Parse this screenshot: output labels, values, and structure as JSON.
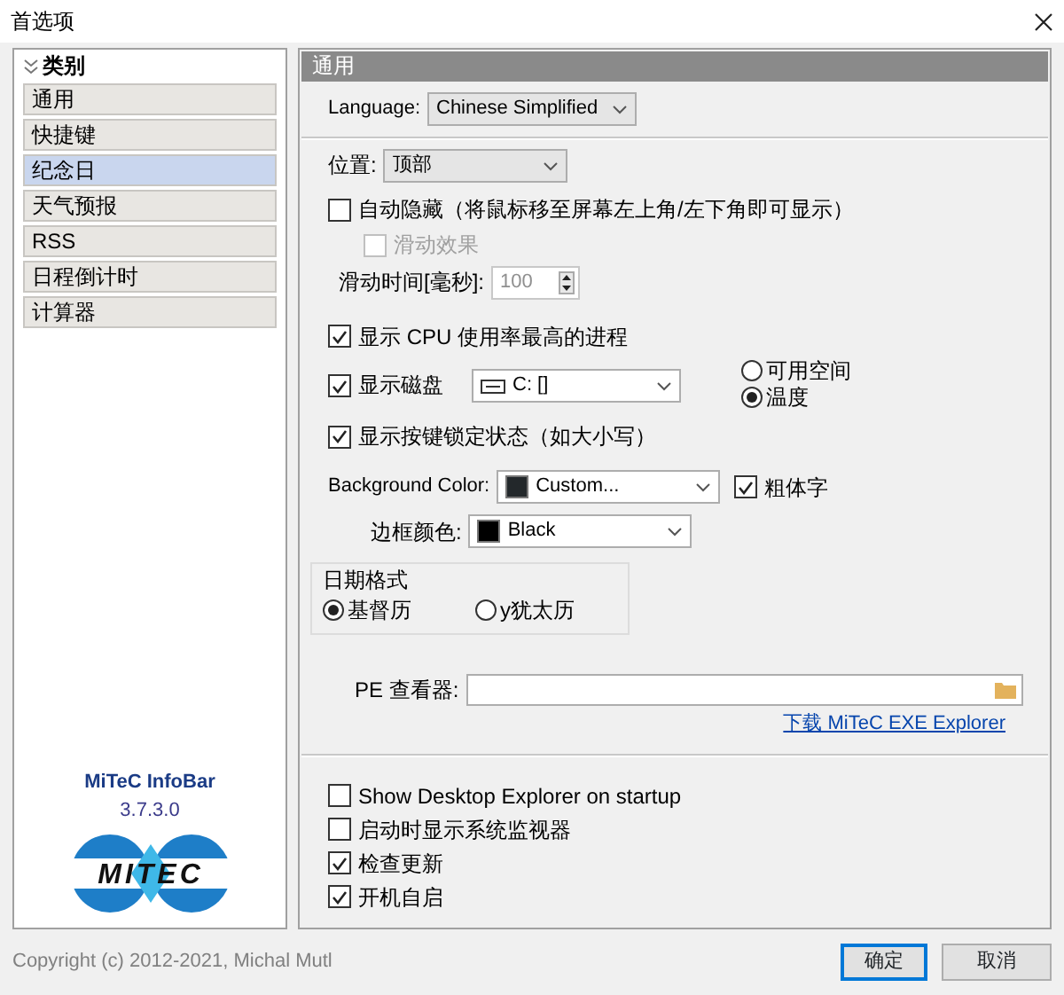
{
  "window": {
    "title": "首选项"
  },
  "sidebar": {
    "header": "类别",
    "items": [
      {
        "label": "通用",
        "selected": false
      },
      {
        "label": "快捷键",
        "selected": false
      },
      {
        "label": "纪念日",
        "selected": true
      },
      {
        "label": "天气预报",
        "selected": false
      },
      {
        "label": "RSS",
        "selected": false
      },
      {
        "label": "日程倒计时",
        "selected": false
      },
      {
        "label": "计算器",
        "selected": false
      }
    ],
    "product_name": "MiTeC InfoBar",
    "version": "3.7.3.0",
    "logo_text": "MITEC"
  },
  "panel": {
    "title": "通用",
    "language": {
      "label": "Language:",
      "value": "Chinese Simplified"
    },
    "position": {
      "label": "位置:",
      "value": "顶部"
    },
    "autohide": {
      "label": "自动隐藏（将鼠标移至屏幕左上角/左下角即可显示）",
      "checked": false
    },
    "slide_effect": {
      "label": "滑动效果",
      "checked": false,
      "disabled": true
    },
    "slide_time": {
      "label": "滑动时间[毫秒]:",
      "value": "100",
      "disabled": true
    },
    "show_cpu": {
      "label": "显示 CPU 使用率最高的进程",
      "checked": true
    },
    "show_disk": {
      "label": "显示磁盘",
      "checked": true,
      "drive": "C: []"
    },
    "disk_modes": [
      {
        "label": "可用空间",
        "selected": false
      },
      {
        "label": "温度",
        "selected": true
      }
    ],
    "show_locks": {
      "label": "显示按键锁定状态（如大小写）",
      "checked": true
    },
    "background": {
      "label": "Background Color:",
      "value": "Custom...",
      "color": "#23282b"
    },
    "bold": {
      "label": "粗体字",
      "checked": true
    },
    "border": {
      "label": "边框颜色:",
      "value": "Black",
      "color": "#000000"
    },
    "date_format": {
      "title": "日期格式",
      "options": [
        {
          "label": "基督历",
          "selected": true
        },
        {
          "label": "y犹太历",
          "selected": false
        }
      ]
    },
    "pe_viewer": {
      "label": "PE 查看器:"
    },
    "download_link": "下载 MiTeC EXE Explorer",
    "startup_options": [
      {
        "label": "Show Desktop Explorer on startup",
        "checked": false
      },
      {
        "label": "启动时显示系统监视器",
        "checked": false
      },
      {
        "label": "检查更新",
        "checked": true
      },
      {
        "label": "开机自启",
        "checked": true
      }
    ]
  },
  "footer": {
    "copyright": "Copyright (c) 2012-2021, Michal Mutl",
    "buttons": [
      {
        "label": "确定",
        "default": true
      },
      {
        "label": "取消",
        "default": false
      }
    ]
  }
}
